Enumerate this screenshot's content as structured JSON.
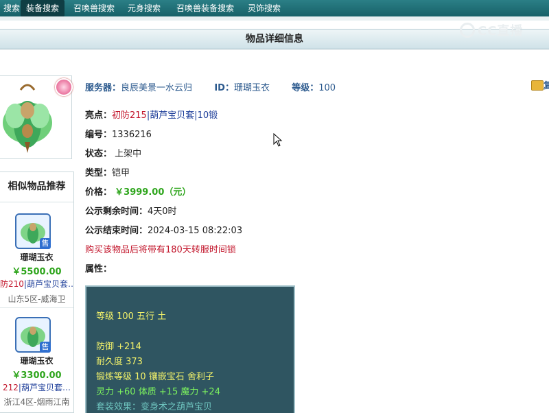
{
  "nav": {
    "tabs": [
      {
        "label": "搜索",
        "active": false
      },
      {
        "label": "装备搜索",
        "active": true
      },
      {
        "label": "召唤兽搜索",
        "active": false
      },
      {
        "label": "元身搜索",
        "active": false
      },
      {
        "label": "召唤兽装备搜索",
        "active": false
      },
      {
        "label": "灵饰搜索",
        "active": false
      }
    ]
  },
  "watermark": "CC直播",
  "header": {
    "title": "物品详细信息"
  },
  "item": {
    "server_label": "服务器：",
    "server_value": "良辰美景一水云归",
    "id_label": "ID：",
    "id_value": "珊瑚玉衣",
    "level_label": "等级：",
    "level_value": "100",
    "fav_label": "复",
    "highlight_label": "亮点：",
    "highlight_1": "初防215",
    "highlight_2": "葫芦宝贝套",
    "highlight_3": "10锻",
    "number_label": "编号：",
    "number_value": "1336216",
    "status_label": "状态：",
    "status_value": "上架中",
    "type_label": "类型：",
    "type_value": "铠甲",
    "price_label": "价格：",
    "price_value": "￥3999.00（元）",
    "remain_label": "公示剩余时间：",
    "remain_value": "4天0时",
    "end_label": "公示结束时间：",
    "end_value": "2024-03-15 08:22:03",
    "notice": "购买该物品后将带有180天转服时间锁",
    "attr_label": "属性："
  },
  "attributes": {
    "line1": "等级 100 五行 土",
    "line2": "防御 +214",
    "line3": "耐久度 373",
    "line4": "锻炼等级 10 镶嵌宝石 舍利子",
    "line5": "灵力 +60 体质 +15 魔力 +24",
    "line6": "套装效果：变身术之葫芦宝贝"
  },
  "sidebar": {
    "title": "相似物品推荐",
    "items": [
      {
        "name": "珊瑚玉衣",
        "price": "￥5500.00",
        "feat_red": "防210",
        "feat_blue": "葫芦宝贝套…",
        "server": "山东5区-威海卫",
        "badge": "售"
      },
      {
        "name": "珊瑚玉衣",
        "price": "￥3300.00",
        "feat_red": "212",
        "feat_blue": "葫芦宝贝套…",
        "server": "浙江4区-烟雨江南",
        "badge": "售"
      }
    ]
  },
  "colors": {
    "nav": "#176168",
    "price": "#2ea51c",
    "highlight": "#c2142a",
    "attr_bg": "#2f5561"
  }
}
